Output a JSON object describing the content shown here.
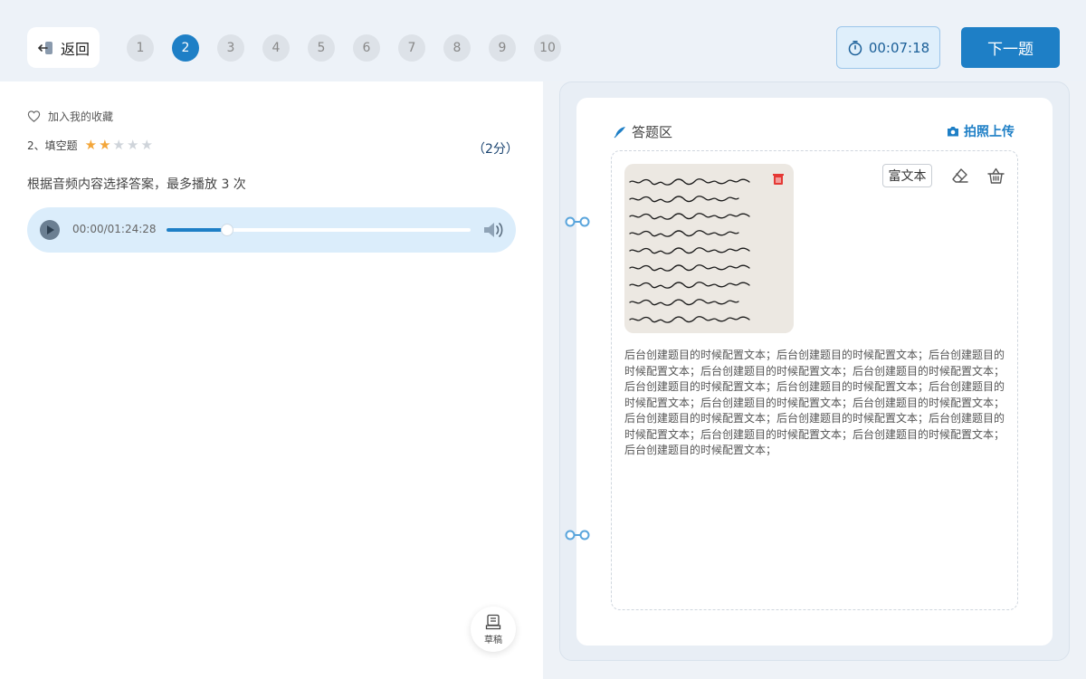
{
  "header": {
    "back_label": "返回",
    "questions": [
      "1",
      "2",
      "3",
      "4",
      "5",
      "6",
      "7",
      "8",
      "9",
      "10"
    ],
    "active_index": 1,
    "timer": "00:07:18",
    "next_label": "下一题"
  },
  "question": {
    "favorite_label": "加入我的收藏",
    "type_label": "2、填空题",
    "difficulty_stars": 2,
    "difficulty_max": 5,
    "score": "（2分）",
    "prompt": "根据音频内容选择答案，最多播放 3 次",
    "audio": {
      "time": "00:00/01:24:28",
      "progress_fraction": 0.2
    }
  },
  "draft_label": "草稿",
  "answer": {
    "title": "答题区",
    "upload_label": "拍照上传",
    "richtext_label": "富文本",
    "text_paragraphs": [
      "后台创建题目的时候配置文本；后台创建题目的时候配置文本；后台创建题目的时候配置文本；后台创建题目的时候配置文本；后台创建题目的时候配置文本；后台创建题目的时候配置文本；后台创建题目的时候配置文本；后台创建题目的时候配置文本；后台创建题目的时候配置文本；后台创建题目的时候配置文本；",
      "后台创建题目的时候配置文本；后台创建题目的时候配置文本；后台创建题目的时候配置文本；后台创建题目的时候配置文本；后台创建题目的时候配置文本；后台创建题目的时候配置文本；"
    ]
  },
  "icons": {
    "back": "back-arrow-icon",
    "timer": "stopwatch-icon",
    "favorite": "heart-icon",
    "star": "star-icon",
    "play": "play-icon",
    "volume": "speaker-icon",
    "draft": "draft-icon",
    "pen": "feather-pen-icon",
    "camera": "camera-icon",
    "delete": "trash-icon",
    "eraser": "eraser-icon",
    "basket": "basket-icon"
  },
  "colors": {
    "accent": "#1e7fc6",
    "star_on": "#f3a63a",
    "star_off": "#cfd4da",
    "delete": "#e53935"
  }
}
